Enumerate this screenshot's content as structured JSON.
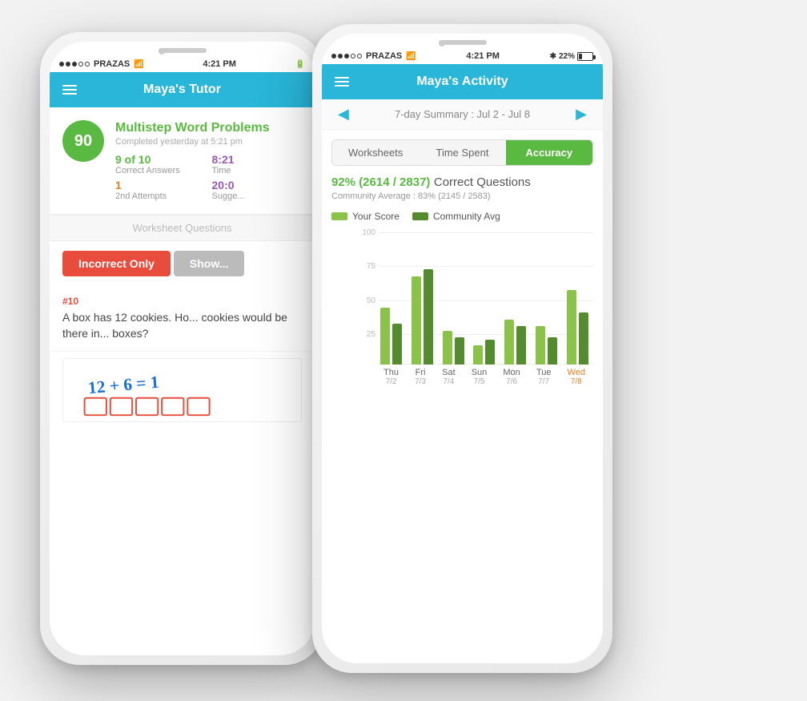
{
  "scene": {
    "background": "#f2f2f2"
  },
  "phone_left": {
    "status": {
      "carrier": "PRAZAS",
      "wifi": "WiFi",
      "time": "4:21 PM"
    },
    "nav": {
      "title": "Maya's Tutor",
      "menu_icon": "☰"
    },
    "score": {
      "badge": "90",
      "title_line1": "Multistep Word Problems",
      "date": "Completed yesterday at 5:21 pm",
      "correct_value": "9 of 10",
      "correct_label": "Correct Answers",
      "time_value": "8:21",
      "time_label": "Time",
      "attempts_value": "1",
      "attempts_label": "2nd Attempts",
      "suggested_value": "20:0",
      "suggested_label": "Sugge..."
    },
    "section": {
      "header": "Worksheet Questions"
    },
    "filter": {
      "active_label": "Incorrect Only",
      "inactive_label": "Show..."
    },
    "question": {
      "number": "#10",
      "text": "A box has 12 cookies. Ho... cookies would be there in... boxes?"
    }
  },
  "phone_right": {
    "status": {
      "carrier": "PRAZAS",
      "wifi": "WiFi",
      "time": "4:21 PM",
      "bluetooth": "BT",
      "battery": "22%"
    },
    "nav": {
      "title": "Maya's Activity",
      "menu_icon": "☰"
    },
    "summary": {
      "prev_icon": "◀",
      "next_icon": "▶",
      "title": "7-day Summary : Jul 2 - Jul 8"
    },
    "tabs": [
      {
        "label": "Worksheets",
        "active": false
      },
      {
        "label": "Time Spent",
        "active": false
      },
      {
        "label": "Accuracy",
        "active": true
      }
    ],
    "accuracy": {
      "main": "92% (2614 / 2837)",
      "label": " Correct Questions",
      "avg": "Community Average : 83% (2145 / 2583)"
    },
    "legend": {
      "your_score_label": "Your Score",
      "community_label": "Community Avg",
      "your_color": "#8bc34a",
      "community_color": "#558b2f"
    },
    "chart": {
      "y_labels": [
        "100",
        "75",
        "50",
        "25"
      ],
      "bars": [
        {
          "day": "Thu",
          "date": "7/2",
          "user": 42,
          "avg": 30,
          "highlight": false
        },
        {
          "day": "Fri",
          "date": "7/3",
          "user": 65,
          "avg": 70,
          "highlight": false
        },
        {
          "day": "Sat",
          "date": "7/4",
          "user": 25,
          "avg": 20,
          "highlight": false
        },
        {
          "day": "Sun",
          "date": "7/5",
          "user": 14,
          "avg": 18,
          "highlight": false
        },
        {
          "day": "Mon",
          "date": "7/6",
          "user": 33,
          "avg": 28,
          "highlight": false
        },
        {
          "day": "Tue",
          "date": "7/7",
          "user": 28,
          "avg": 20,
          "highlight": false
        },
        {
          "day": "Wed",
          "date": "7/8",
          "user": 55,
          "avg": 38,
          "highlight": true
        }
      ]
    }
  }
}
